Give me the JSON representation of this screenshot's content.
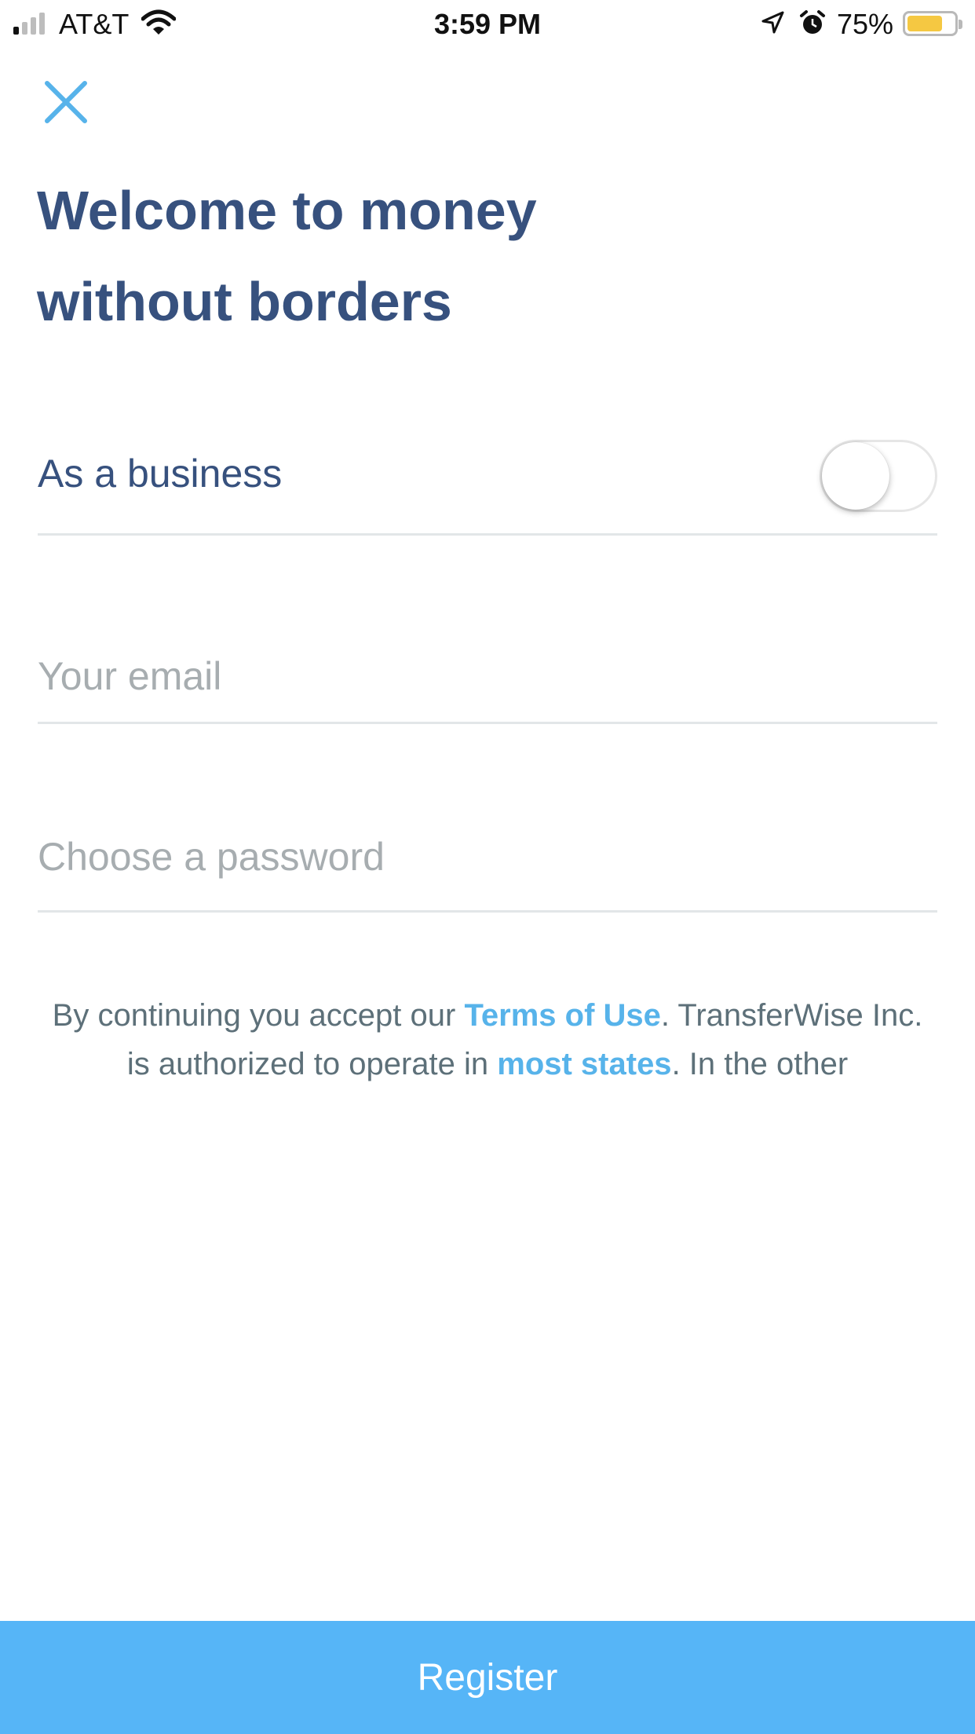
{
  "status_bar": {
    "carrier": "AT&T",
    "time": "3:59 PM",
    "battery_percent": "75%",
    "battery_level": 0.75,
    "battery_color": "#f5c842",
    "icons": [
      "signal-icon",
      "wifi-icon",
      "location-icon",
      "alarm-icon",
      "battery-icon"
    ]
  },
  "header": {
    "close_icon": "close-icon",
    "title_line1": "Welcome to money",
    "title_line2": "without borders"
  },
  "form": {
    "business_label": "As a business",
    "business_toggle_on": false,
    "email_placeholder": "Your email",
    "password_placeholder": "Choose a password"
  },
  "legal": {
    "text_1": "By continuing you accept our ",
    "terms_link": "Terms of Use",
    "text_2": ". TransferWise Inc. is authorized to operate in ",
    "states_link": "most states",
    "text_3": ". In the other"
  },
  "footer": {
    "register_label": "Register"
  },
  "colors": {
    "title": "#37517e",
    "accent": "#57b3ea",
    "button": "#56b5f7",
    "placeholder": "#a7adb0",
    "body_text": "#5d7079"
  }
}
